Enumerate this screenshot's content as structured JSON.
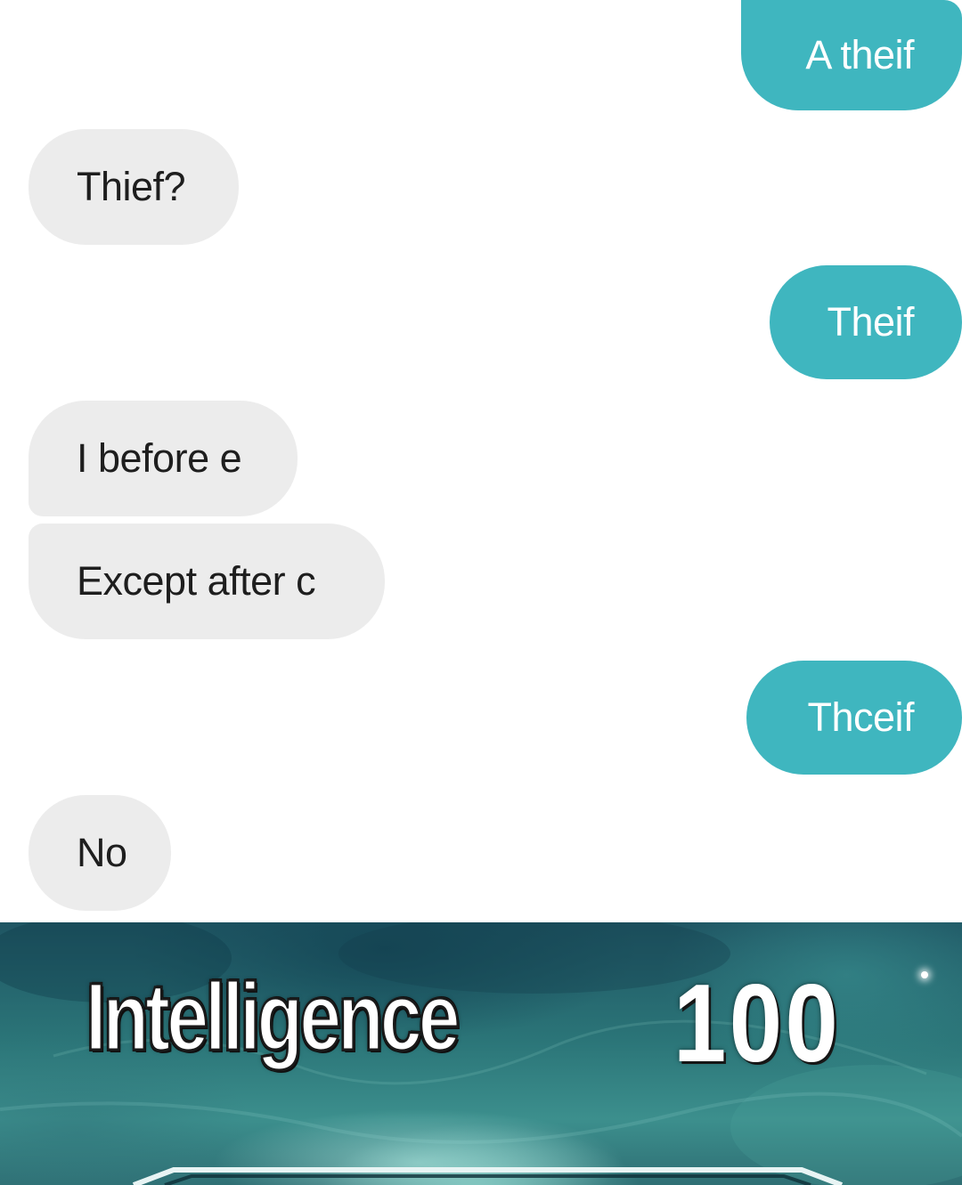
{
  "conversation": {
    "messages": [
      {
        "side": "sent",
        "text": "A theif"
      },
      {
        "side": "received",
        "text": "Thief?"
      },
      {
        "side": "sent",
        "text": "Theif"
      },
      {
        "side": "received",
        "text": "I before e"
      },
      {
        "side": "received",
        "text": "Except after c"
      },
      {
        "side": "sent",
        "text": "Thceif"
      },
      {
        "side": "received",
        "text": "No"
      }
    ],
    "colors": {
      "sent_bubble": "#3fb6bf",
      "received_bubble": "#ececec",
      "sent_text": "#ffffff",
      "received_text": "#1e1e1e"
    }
  },
  "meme": {
    "skill_name": "Intelligence",
    "skill_level": "100",
    "colors": {
      "background": "#2b7578",
      "text": "#ffffff"
    }
  }
}
